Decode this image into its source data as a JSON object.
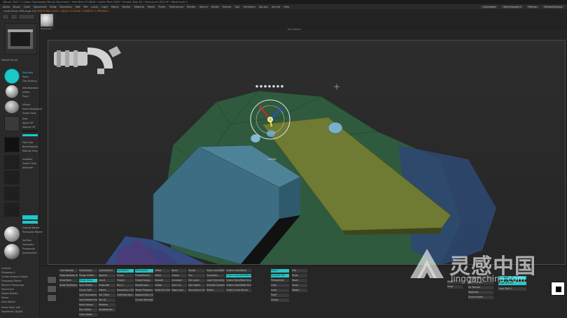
{
  "titlebar": {
    "title": "ZBrush 2021.7.1 [Sean Chomwata]   ZBrush Document   • Free Mem 57.68GB • Active Mem 1560 • Scratch Disk 48 • Polycount 2.812 KP • MeshCount 1",
    "right": [
      "QuickSave",
      "See-through 0",
      "Menus",
      "DefaultZScript"
    ]
  },
  "menubar": {
    "items": [
      "Alpha",
      "Brush",
      "Color",
      "Document",
      "Draw",
      "Dynamics",
      "Edit",
      "File",
      "Layer",
      "Light",
      "Macro",
      "Marker",
      "Material",
      "Movie",
      "Picker",
      "Preferences",
      "Render",
      "Stencil",
      "Stroke",
      "Texture",
      "Tool",
      "Transform",
      "Zplugin",
      "Zscript",
      "Help"
    ],
    "right": [
      "QuickSave",
      "See-through 0",
      "Menus",
      "DefaultZScript"
    ]
  },
  "statusbar": {
    "left": "◂ Undo   Points 3990 Angle 105",
    "highlight": "SMOOTHING LEVEL 2  ANGLE 45  SHOW 1 VISIBILITY 1 PREVIEW 1"
  },
  "leftpanel": {
    "labels": [
      "Quick Sketch",
      "LightBox",
      "Smooth Brush",
      "Load Brush",
      "Clay",
      "Standard",
      "Move",
      "Clay Buildup",
      "DamStandard",
      "Inflate",
      "Pinch",
      "hPolish",
      "Move Topological",
      "Snake Hook",
      "Dots",
      "Alpha Off",
      "Texture Off",
      "Flat Color",
      "BasicMaterial",
      "MatCap Gray",
      "Gradient",
      "Switch Color",
      "Alternate",
      "Subtool Master",
      "Transpose Master",
      "SubTool",
      "Geometry",
      "Polygroups",
      "Deformation"
    ],
    "bottom_labels": [
      "Inventor",
      "Polygroup It",
      "Create Instance Object",
      "Transpose Master",
      "Rename Polygroups",
      "Stored Uvs",
      "Delete Hidden",
      "Sheen",
      "Auto Master",
      "Active Point 100",
      "TotalPoints 36,648"
    ]
  },
  "topstrip": {
    "thumb_label": "Polysphere",
    "tool_label": "Tool Options"
  },
  "viewport": {
    "transpose_value": "1.6508"
  },
  "bottombar": {
    "col1": [
      "Live Boolean",
      "Make Boolean Mesh",
      "Draw Both",
      "Draw Polyframe"
    ],
    "col2": [
      "PolyGroupIt",
      "Merge Visible",
      "Merge Down",
      "Split Hidden",
      "Group Split",
      "Split Unmasked Points",
      "Split Masked Points",
      "Auto Groups",
      "Del Hidden",
      "Close Holes"
    ],
    "col3": [
      "QuickSketch",
      "Append",
      "Insert",
      "Duplicate",
      "Delete",
      "Del Other",
      "Del All",
      "Rename",
      "AutoReorder"
    ],
    "col4": [
      "DynaMesh",
      "Group",
      "Project",
      "Blur 2",
      "Resolution 128",
      "SubProjection 0.6"
    ],
    "col5": [
      "ZRemesher",
      "FreezeBorder",
      "FreezeGroups",
      "KeepGroups",
      "Target Polygons Count 5",
      "AdaptiveSize 50",
      "Curves Strength 50"
    ],
    "col6": [
      "Offset",
      "Mirror",
      "Smooth",
      "Inflate",
      "Polish By Features"
    ],
    "col7": [
      "Bevel",
      "Crease",
      "Uncrease",
      "Slice Crv",
      "Edge Loop"
    ],
    "col8": [
      "Divide",
      "Suv",
      "Del Lower",
      "Del Higher",
      "Reconstruct Subdiv"
    ],
    "col9": [
      "Mirror And Weld",
      "Symmetry",
      "Local Symmetry",
      "Activate Symmetry",
      "Radial"
    ],
    "col10": [
      "Create InsertMesh",
      "Create InsertMultiMesh",
      "Create NanoMesh Brush",
      "Create InsertMesh Brush",
      "Create Curve Brush"
    ],
    "col11": [
      "Mirror",
      "Sculptris Pro",
      "Perspective",
      "Floor",
      "Local",
      "PolyF",
      "Transp"
    ],
    "col12": [
      "Edit",
      "Draw",
      "Move",
      "Scale",
      "Rotate"
    ],
    "right_labels": [
      "Polygroups",
      "Auto Groups",
      "Ds Texture",
      "Radiosity",
      "Ground Ratio"
    ],
    "zadd": "Zadd",
    "zsub": "Zsub",
    "intensity": "Z Intensity 25",
    "draw_size": "Draw Size 64",
    "focal": "Focal Shift 0"
  },
  "watermark": {
    "text": "灵感中国",
    "url": "lingganchina.com"
  },
  "colors": {
    "accent": "#29c7c7",
    "orange": "#e07a1a",
    "object_green": "#2f5a3e",
    "object_blue": "#3a6a8a",
    "plate_yellow": "#6f7a32"
  },
  "icons": [
    "logo-icon",
    "pipe-thumbnail-icon",
    "cursor-cross-icon",
    "transpose-gizmo-icon",
    "bolt-icon"
  ]
}
